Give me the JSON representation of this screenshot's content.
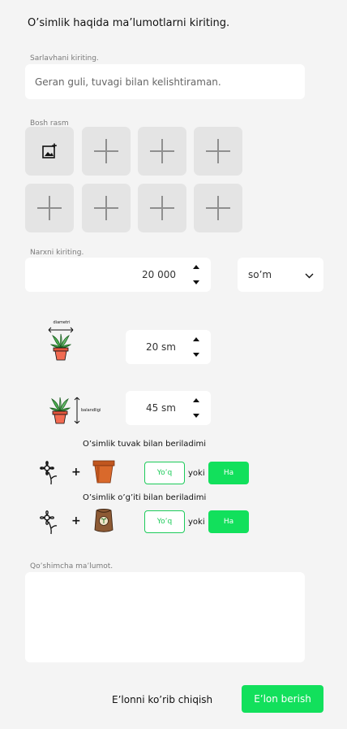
{
  "header": {
    "title": "O’simlik haqida ma’lumotlarni kiriting."
  },
  "title_field": {
    "label": "Sarlavhani kiriting.",
    "value": "Geran guli, tuvagi bilan kelishtiraman."
  },
  "images": {
    "label": "Bosh rasm",
    "first_tile_icon": "add-image-icon",
    "tile_icon": "plus-icon"
  },
  "price": {
    "label": "Narxni kiriting.",
    "value": "20 000",
    "currency": "so’m"
  },
  "diameter": {
    "caption": "diametri",
    "value": "20 sm"
  },
  "height": {
    "caption": "balandligi",
    "value": "45 sm"
  },
  "pot_question": {
    "text": "O’simlik tuvak bilan beriladimi",
    "plus": "+",
    "no": "Yo’q",
    "or": "yoki",
    "yes": "Ha"
  },
  "fertilizer_question": {
    "text": "O’simlik o’g’iti bilan beriladimi",
    "plus": "+",
    "no": "Yo’q",
    "or": "yoki",
    "yes": "Ha"
  },
  "extra": {
    "label": "Qo’shimcha ma’lumot.",
    "value": ""
  },
  "footer": {
    "preview": "E’lonni ko’rib chiqish",
    "submit": "E’lon berish"
  },
  "colors": {
    "accent": "#12e05c",
    "outline": "#1dcb5a",
    "tile": "#e4e4e4"
  }
}
